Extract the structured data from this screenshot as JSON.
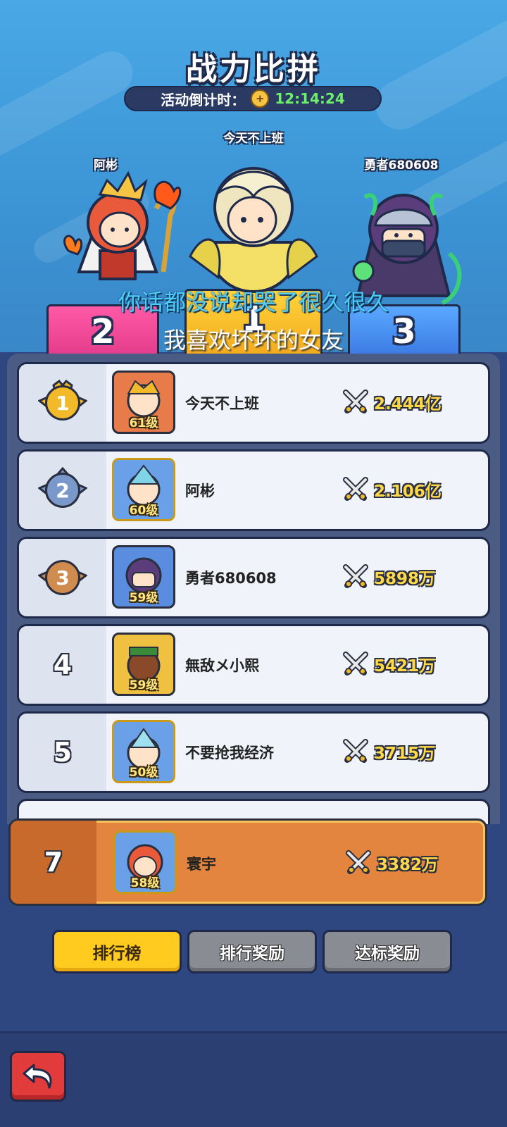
{
  "header": {
    "title": "战力比拼",
    "countdown_label": "活动倒计时：",
    "countdown_time": "12:14:24"
  },
  "podium": [
    {
      "rank": "1",
      "name": "今天不上班"
    },
    {
      "rank": "2",
      "name": "阿彬"
    },
    {
      "rank": "3",
      "name": "勇者680608"
    }
  ],
  "subtitles": {
    "line1": "你话都没说却哭了很久很久",
    "line2": "我喜欢坏坏的女友"
  },
  "leaderboard": [
    {
      "rank": "1",
      "name": "今天不上班",
      "level": "61级",
      "power": "2.444亿"
    },
    {
      "rank": "2",
      "name": "阿彬",
      "level": "60级",
      "power": "2.106亿"
    },
    {
      "rank": "3",
      "name": "勇者680608",
      "level": "59级",
      "power": "5898万"
    },
    {
      "rank": "4",
      "name": "無敌メ小熙",
      "level": "59级",
      "power": "5421万"
    },
    {
      "rank": "5",
      "name": "不要抢我经济",
      "level": "50级",
      "power": "3715万"
    }
  ],
  "self": {
    "rank": "7",
    "name": "寰宇",
    "level": "58级",
    "power": "3382万"
  },
  "tabs": [
    {
      "label": "排行榜",
      "active": true
    },
    {
      "label": "排行奖励",
      "active": false
    },
    {
      "label": "达标奖励",
      "active": false
    }
  ],
  "colors": {
    "gold": "#f2b92b",
    "silver": "#7a98c9",
    "bronze": "#d08b4e",
    "self_row": "#e3843f",
    "tab_active": "#ffcb1f"
  }
}
